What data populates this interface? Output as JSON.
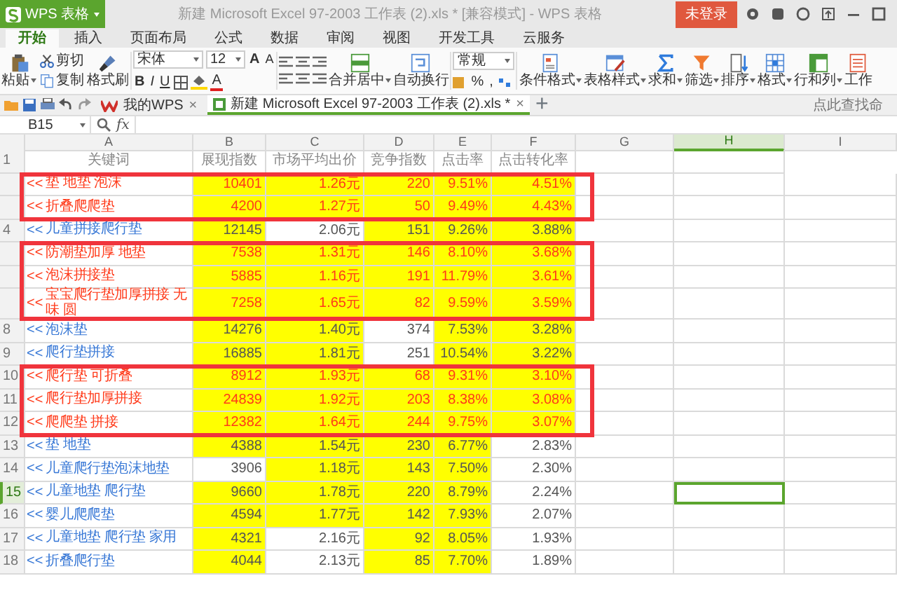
{
  "title_bar": {
    "app_name": "WPS 表格",
    "title": "新建 Microsoft Excel 97-2003 工作表 (2).xls * [兼容模式] - WPS 表格",
    "login_button": "未登录"
  },
  "ribbon_tabs": [
    {
      "label": "开始",
      "selected": true
    },
    {
      "label": "插入",
      "selected": false
    },
    {
      "label": "页面布局",
      "selected": false
    },
    {
      "label": "公式",
      "selected": false
    },
    {
      "label": "数据",
      "selected": false
    },
    {
      "label": "审阅",
      "selected": false
    },
    {
      "label": "视图",
      "selected": false
    },
    {
      "label": "开发工具",
      "selected": false
    },
    {
      "label": "云服务",
      "selected": false
    }
  ],
  "ribbon": {
    "paste": "粘贴",
    "cut": "剪切",
    "copy": "复制",
    "format_painter": "格式刷",
    "font_name": "宋体",
    "font_size": "12",
    "grow_font": "A",
    "shrink_font": "A",
    "style_buttons": [
      "B",
      "I",
      "U"
    ],
    "font_color": "A",
    "merge": "合并居中",
    "wrap": "自动换行",
    "number_format": "常规",
    "percent": "%",
    "comma": ",",
    "tools": [
      "条件格式",
      "表格样式",
      "求和",
      "筛选",
      "排序",
      "格式",
      "行和列",
      "工作"
    ]
  },
  "doc_tabs": [
    {
      "label": "我的WPS",
      "close": "×",
      "selected": false
    },
    {
      "label": "新建 Microsoft Excel 97-2003 工作表 (2).xls *",
      "close": "×",
      "selected": true
    }
  ],
  "new_tab_button": "+",
  "command_search": {
    "placeholder": "点此查找命"
  },
  "formula_bar": {
    "name_box": "B15",
    "fx": "fx"
  },
  "sheet": {
    "columns": [
      {
        "label": "A",
        "selected": false
      },
      {
        "label": "B",
        "selected": false
      },
      {
        "label": "C",
        "selected": false
      },
      {
        "label": "D",
        "selected": false
      },
      {
        "label": "E",
        "selected": false
      },
      {
        "label": "F",
        "selected": false
      },
      {
        "label": "G",
        "selected": false
      },
      {
        "label": "H",
        "selected": true
      },
      {
        "label": "I",
        "selected": false
      }
    ],
    "header_row": {
      "number": "1",
      "cells": [
        "关键词",
        "展现指数",
        "市场平均出价",
        "竞争指数",
        "点击率",
        "点击转化率"
      ]
    },
    "rows": [
      {
        "marker": "<<",
        "keyword": "垫 地垫 泡沫",
        "flagged": true,
        "selected": false,
        "values": [
          {
            "text": "10401",
            "fill": true
          },
          {
            "text": "1.26元",
            "fill": true
          },
          {
            "text": "220",
            "fill": true
          },
          {
            "text": "9.51%",
            "fill": true
          },
          {
            "text": "4.51%",
            "fill": true
          }
        ]
      },
      {
        "marker": "<<",
        "keyword": "折叠爬爬垫",
        "flagged": true,
        "selected": false,
        "values": [
          {
            "text": "4200",
            "fill": true
          },
          {
            "text": "1.27元",
            "fill": true
          },
          {
            "text": "50",
            "fill": true
          },
          {
            "text": "9.49%",
            "fill": true
          },
          {
            "text": "4.43%",
            "fill": true
          }
        ]
      },
      {
        "number": "4",
        "marker": "<<",
        "keyword": "儿童拼接爬行垫",
        "flagged": false,
        "selected": false,
        "values": [
          {
            "text": "12145",
            "fill": true
          },
          {
            "text": "2.06元",
            "fill": false
          },
          {
            "text": "151",
            "fill": true
          },
          {
            "text": "9.26%",
            "fill": true
          },
          {
            "text": "3.88%",
            "fill": true
          }
        ]
      },
      {
        "marker": "<<",
        "keyword": "防潮垫加厚 地垫",
        "flagged": true,
        "selected": false,
        "values": [
          {
            "text": "7538",
            "fill": true
          },
          {
            "text": "1.31元",
            "fill": true
          },
          {
            "text": "146",
            "fill": true
          },
          {
            "text": "8.10%",
            "fill": true
          },
          {
            "text": "3.68%",
            "fill": true
          }
        ]
      },
      {
        "marker": "<<",
        "keyword": "泡沫拼接垫",
        "flagged": true,
        "selected": false,
        "values": [
          {
            "text": "5885",
            "fill": true
          },
          {
            "text": "1.16元",
            "fill": true
          },
          {
            "text": "191",
            "fill": true
          },
          {
            "text": "11.79%",
            "fill": true
          },
          {
            "text": "3.61%",
            "fill": true
          }
        ]
      },
      {
        "marker": "<<",
        "keyword": "宝宝爬行垫加厚拼接 无味 圆",
        "flagged": true,
        "selected": false,
        "values": [
          {
            "text": "7258",
            "fill": true
          },
          {
            "text": "1.65元",
            "fill": true
          },
          {
            "text": "82",
            "fill": true
          },
          {
            "text": "9.59%",
            "fill": true
          },
          {
            "text": "3.59%",
            "fill": true
          }
        ]
      },
      {
        "number": "8",
        "marker": "<<",
        "keyword": "泡沫垫",
        "flagged": false,
        "selected": false,
        "values": [
          {
            "text": "14276",
            "fill": true
          },
          {
            "text": "1.40元",
            "fill": true
          },
          {
            "text": "374",
            "fill": false
          },
          {
            "text": "7.53%",
            "fill": true
          },
          {
            "text": "3.28%",
            "fill": true
          }
        ]
      },
      {
        "number": "9",
        "marker": "<<",
        "keyword": "爬行垫拼接",
        "flagged": false,
        "selected": false,
        "values": [
          {
            "text": "16885",
            "fill": true
          },
          {
            "text": "1.81元",
            "fill": true
          },
          {
            "text": "251",
            "fill": false
          },
          {
            "text": "10.54%",
            "fill": true
          },
          {
            "text": "3.22%",
            "fill": true
          }
        ]
      },
      {
        "number": "10",
        "marker": "<<",
        "keyword": "爬行垫 可折叠",
        "flagged": true,
        "selected": false,
        "values": [
          {
            "text": "8912",
            "fill": true
          },
          {
            "text": "1.93元",
            "fill": true
          },
          {
            "text": "68",
            "fill": true
          },
          {
            "text": "9.31%",
            "fill": true
          },
          {
            "text": "3.10%",
            "fill": true
          }
        ]
      },
      {
        "number": "11",
        "marker": "<<",
        "keyword": "爬行垫加厚拼接",
        "flagged": true,
        "selected": false,
        "values": [
          {
            "text": "24839",
            "fill": true
          },
          {
            "text": "1.92元",
            "fill": true
          },
          {
            "text": "203",
            "fill": true
          },
          {
            "text": "8.38%",
            "fill": true
          },
          {
            "text": "3.08%",
            "fill": true
          }
        ]
      },
      {
        "number": "12",
        "marker": "<<",
        "keyword": "爬爬垫 拼接",
        "flagged": true,
        "selected": false,
        "values": [
          {
            "text": "12382",
            "fill": true
          },
          {
            "text": "1.64元",
            "fill": true
          },
          {
            "text": "244",
            "fill": true
          },
          {
            "text": "9.75%",
            "fill": true
          },
          {
            "text": "3.07%",
            "fill": true
          }
        ]
      },
      {
        "number": "13",
        "marker": "<<",
        "keyword": "垫 地垫",
        "flagged": false,
        "selected": false,
        "values": [
          {
            "text": "4388",
            "fill": true
          },
          {
            "text": "1.54元",
            "fill": true
          },
          {
            "text": "230",
            "fill": true
          },
          {
            "text": "6.77%",
            "fill": true
          },
          {
            "text": "2.83%",
            "fill": false
          }
        ]
      },
      {
        "number": "14",
        "marker": "<<",
        "keyword": "儿童爬行垫泡沫地垫",
        "flagged": false,
        "selected": false,
        "values": [
          {
            "text": "3906",
            "fill": false
          },
          {
            "text": "1.18元",
            "fill": true
          },
          {
            "text": "143",
            "fill": true
          },
          {
            "text": "7.50%",
            "fill": true
          },
          {
            "text": "2.30%",
            "fill": false
          }
        ]
      },
      {
        "number": "15",
        "marker": "<<",
        "keyword": "儿童地垫 爬行垫",
        "flagged": false,
        "selected": true,
        "values": [
          {
            "text": "9660",
            "fill": true
          },
          {
            "text": "1.78元",
            "fill": true
          },
          {
            "text": "220",
            "fill": true
          },
          {
            "text": "8.79%",
            "fill": true
          },
          {
            "text": "2.24%",
            "fill": false
          }
        ]
      },
      {
        "number": "16",
        "marker": "<<",
        "keyword": "婴儿爬爬垫",
        "flagged": false,
        "selected": false,
        "values": [
          {
            "text": "4594",
            "fill": true
          },
          {
            "text": "1.77元",
            "fill": true
          },
          {
            "text": "142",
            "fill": true
          },
          {
            "text": "7.93%",
            "fill": true
          },
          {
            "text": "2.07%",
            "fill": false
          }
        ]
      },
      {
        "number": "17",
        "marker": "<<",
        "keyword": "儿童地垫 爬行垫 家用",
        "flagged": false,
        "selected": false,
        "values": [
          {
            "text": "4321",
            "fill": true
          },
          {
            "text": "2.16元",
            "fill": false
          },
          {
            "text": "92",
            "fill": true
          },
          {
            "text": "8.05%",
            "fill": true
          },
          {
            "text": "1.93%",
            "fill": false
          }
        ]
      },
      {
        "number": "18",
        "marker": "<<",
        "keyword": "折叠爬行垫",
        "flagged": false,
        "selected": false,
        "values": [
          {
            "text": "4044",
            "fill": true
          },
          {
            "text": "2.13元",
            "fill": false
          },
          {
            "text": "85",
            "fill": true
          },
          {
            "text": "7.70%",
            "fill": true
          },
          {
            "text": "1.89%",
            "fill": false
          }
        ]
      }
    ]
  }
}
